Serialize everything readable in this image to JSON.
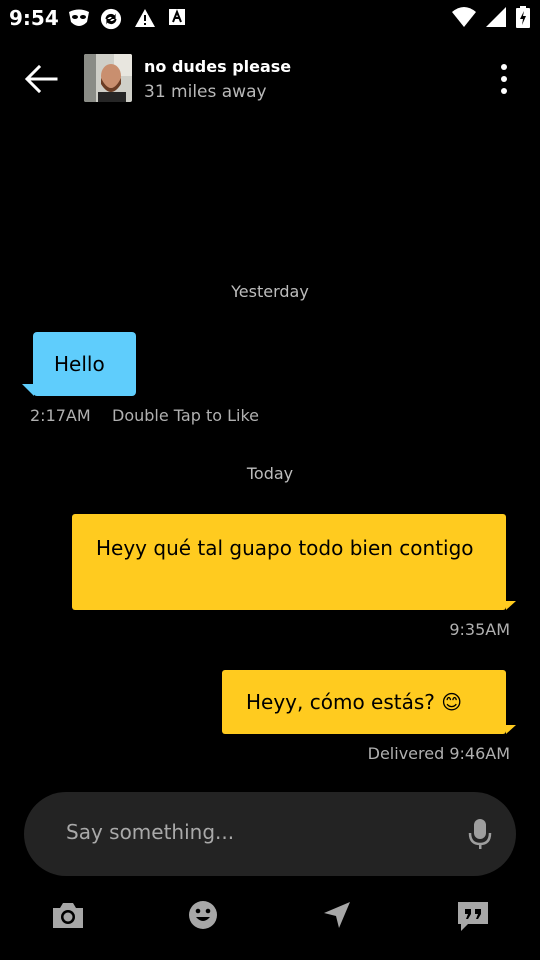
{
  "status_bar": {
    "time": "9:54",
    "icons": [
      "grindr-mask-icon",
      "sync-icon",
      "warning-icon",
      "font-icon",
      "wifi-icon",
      "signal-icon",
      "battery-icon"
    ]
  },
  "header": {
    "name": "no dudes please",
    "distance": "31 miles away"
  },
  "chat": {
    "separators": [
      "Yesterday",
      "Today"
    ],
    "messages": [
      {
        "direction": "incoming",
        "text": "Hello",
        "time": "2:17AM",
        "hint": "Double Tap to Like"
      },
      {
        "direction": "outgoing",
        "text": "Heyy qué tal guapo todo bien contigo",
        "meta": "9:35AM"
      },
      {
        "direction": "outgoing",
        "text": "Heyy, cómo estás? 😊",
        "meta": "Delivered 9:46AM"
      }
    ]
  },
  "composer": {
    "placeholder": "Say something..."
  },
  "toolbar": {
    "icons": [
      "camera-icon",
      "emoji-icon",
      "location-icon",
      "saved-phrases-icon"
    ]
  },
  "colors": {
    "background": "#000000",
    "incoming_bubble": "#5fcdfc",
    "outgoing_bubble": "#ffcb1f",
    "composer": "#232323"
  }
}
